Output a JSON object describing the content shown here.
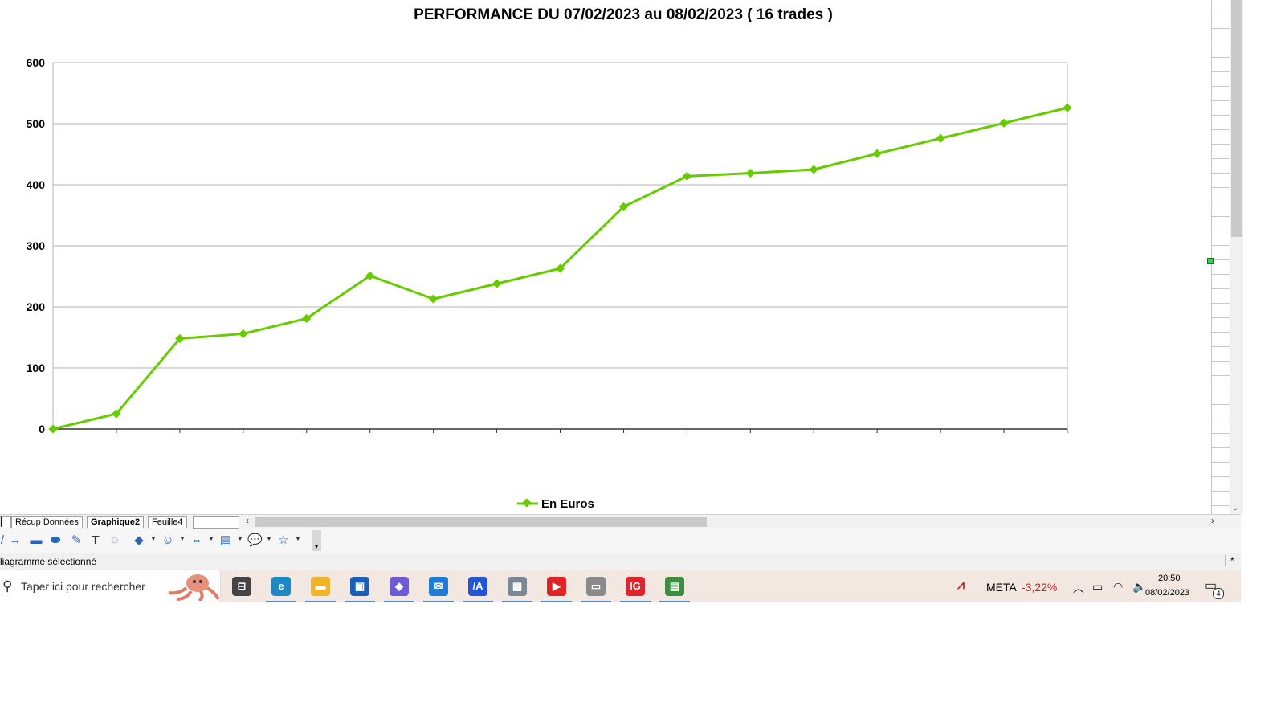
{
  "chart_data": {
    "type": "line",
    "title": "PERFORMANCE DU 07/02/2023 au 08/02/2023 ( 16 trades )",
    "ylim": [
      0,
      600
    ],
    "yticks": [
      "0",
      "100",
      "200",
      "300",
      "400",
      "500",
      "600"
    ],
    "grid": true,
    "legend_position": "bottom",
    "series": [
      {
        "name": "En Euros",
        "color": "#66cc00",
        "values": [
          0,
          25,
          148,
          156,
          181,
          251,
          213,
          238,
          263,
          364,
          414,
          419,
          425,
          451,
          476,
          501,
          526
        ]
      }
    ]
  },
  "sheet_tabs": [
    {
      "label": "Récup Données",
      "active": false
    },
    {
      "label": "Graphique2",
      "active": true
    },
    {
      "label": "Feuille4",
      "active": false
    }
  ],
  "status_bar": {
    "text": "liagramme sélectionné",
    "right": "*"
  },
  "taskbar": {
    "search_placeholder": "Taper ici pour rechercher",
    "apps": [
      {
        "name": "task-view",
        "glyph": "⊟",
        "color": "#444444"
      },
      {
        "name": "edge",
        "glyph": "e",
        "color": "#1e88c7"
      },
      {
        "name": "file-explorer",
        "glyph": "▬",
        "color": "#f0b429"
      },
      {
        "name": "store",
        "glyph": "▣",
        "color": "#1a5fb4"
      },
      {
        "name": "teams",
        "glyph": "◆",
        "color": "#6b5cd6"
      },
      {
        "name": "mail",
        "glyph": "✉",
        "color": "#1e7ad9"
      },
      {
        "name": "app-blue",
        "glyph": "/A",
        "color": "#2454d6"
      },
      {
        "name": "calculator",
        "glyph": "▦",
        "color": "#7a8896"
      },
      {
        "name": "youtube",
        "glyph": "▶",
        "color": "#e02424"
      },
      {
        "name": "app-image",
        "glyph": "▭",
        "color": "#8a8a8a"
      },
      {
        "name": "ig",
        "glyph": "IG",
        "color": "#e0242b"
      },
      {
        "name": "calc-sheet",
        "glyph": "▤",
        "color": "#3e8e41"
      }
    ],
    "ticker": {
      "symbol": "META",
      "change": "-3,22%"
    },
    "clock": {
      "time": "20:50",
      "date": "08/02/2023"
    },
    "notifications": "4"
  }
}
